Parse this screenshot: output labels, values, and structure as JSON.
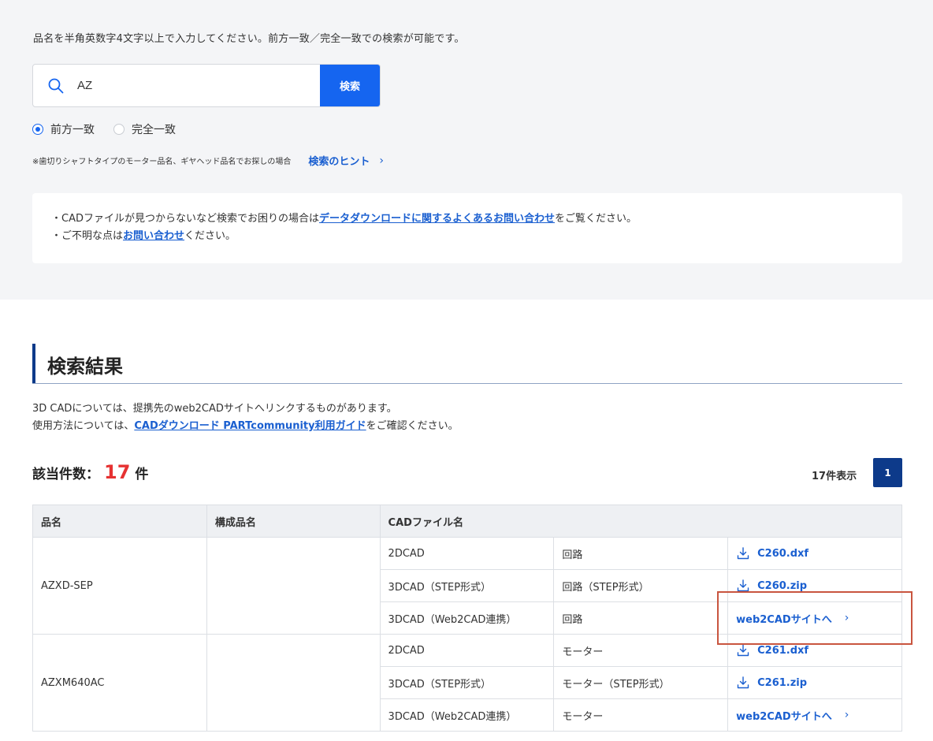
{
  "search": {
    "instruction": "品名を半角英数字4文字以上で入力してください。前方一致／完全一致での検索が可能です。",
    "query": "AZ",
    "button_label": "検索",
    "match_options": [
      {
        "label": "前方一致",
        "checked": true
      },
      {
        "label": "完全一致",
        "checked": false
      }
    ],
    "hint_note": "※歯切りシャフトタイプのモーター品名、ギヤヘッド品名でお探しの場合",
    "hint_link": "検索のヒント",
    "icon": "search-icon"
  },
  "notice": {
    "line1_prefix": "・CADファイルが見つからないなど検索でお困りの場合は",
    "line1_link": "データダウンロードに関するよくあるお問い合わせ",
    "line1_suffix": "をご覧ください。",
    "line2_prefix": "・ご不明な点は",
    "line2_link": "お問い合わせ",
    "line2_suffix": "ください。"
  },
  "results": {
    "title": "検索結果",
    "desc_line1": "3D CADについては、提携先のweb2CADサイトへリンクするものがあります。",
    "desc_line2_prefix": "使用方法については、",
    "desc_line2_link": "CADダウンロード PARTcommunity利用ガイド",
    "desc_line2_suffix": "をご確認ください。",
    "count_label": "該当件数：",
    "count": "17",
    "count_unit": "件",
    "display_count": "17件表示",
    "page": "1"
  },
  "table": {
    "headers": [
      "品名",
      "構成品名",
      "CADファイル名"
    ],
    "groups": [
      {
        "name": "AZXD-SEP",
        "sub": "",
        "rows": [
          {
            "type": "2DCAD",
            "part": "回路",
            "link": "C260.dxf",
            "kind": "download"
          },
          {
            "type": "3DCAD（STEP形式）",
            "part": "回路（STEP形式）",
            "link": "C260.zip",
            "kind": "download"
          },
          {
            "type": "3DCAD（Web2CAD連携）",
            "part": "回路",
            "link": "web2CADサイトへ",
            "kind": "web"
          }
        ]
      },
      {
        "name": "AZXM640AC",
        "sub": "",
        "rows": [
          {
            "type": "2DCAD",
            "part": "モーター",
            "link": "C261.dxf",
            "kind": "download"
          },
          {
            "type": "3DCAD（STEP形式）",
            "part": "モーター（STEP形式）",
            "link": "C261.zip",
            "kind": "download"
          },
          {
            "type": "3DCAD（Web2CAD連携）",
            "part": "モーター",
            "link": "web2CADサイトへ",
            "kind": "web"
          }
        ]
      }
    ]
  },
  "colors": {
    "accent": "#1565f0",
    "link": "#1a5fd0",
    "navy": "#0d3a8a",
    "count": "#e63232",
    "highlight": "#c9553f"
  }
}
